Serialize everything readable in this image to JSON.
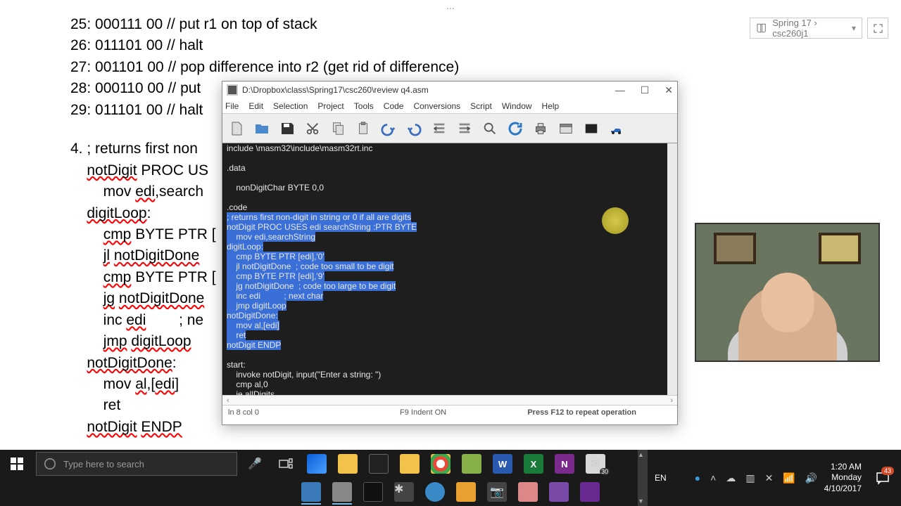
{
  "top": {
    "dots": "...",
    "notebook": "Spring 17 › csc260j1"
  },
  "doc": {
    "lines": [
      "25: 000111 00 // put r1 on top of stack",
      "26: 011101 00 // halt",
      "27: 001101 00 // pop difference into r2 (get rid of difference)",
      "28: 000110 00 // put",
      "29: 011101 00 // halt"
    ],
    "q4_num": "4.",
    "q4": [
      "    ; returns first non",
      "    notDigit PROC US",
      "        mov edi,search",
      "    digitLoop:",
      "        cmp BYTE PTR [",
      "        jl notDigitDone",
      "        cmp BYTE PTR [",
      "        jg notDigitDone",
      "        inc edi        ; ne",
      "        jmp digitLoop",
      "    notDigitDone:",
      "        mov al,[edi]",
      "        ret",
      "    notDigit ENDP"
    ]
  },
  "editor": {
    "title": "D:\\Dropbox\\class\\Spring17\\csc260\\review q4.asm",
    "menu": [
      "File",
      "Edit",
      "Selection",
      "Project",
      "Tools",
      "Code",
      "Conversions",
      "Script",
      "Window",
      "Help"
    ],
    "code": [
      {
        "t": "include \\masm32\\include\\masm32rt.inc",
        "s": 0
      },
      {
        "t": "",
        "s": 0
      },
      {
        "t": ".data",
        "s": 0
      },
      {
        "t": "",
        "s": 0
      },
      {
        "t": "    nonDigitChar BYTE 0,0",
        "s": 0
      },
      {
        "t": "",
        "s": 0
      },
      {
        "t": ".code",
        "s": 0
      },
      {
        "t": "; returns first non-digit in string or 0 if all are digits",
        "s": 1
      },
      {
        "t": "notDigit PROC USES edi searchString :PTR BYTE",
        "s": 1
      },
      {
        "t": "    mov edi,searchString",
        "s": 1
      },
      {
        "t": "digitLoop:",
        "s": 1
      },
      {
        "t": "    cmp BYTE PTR [edi],'0'",
        "s": 1
      },
      {
        "t": "    jl notDigitDone  ; code too small to be digit",
        "s": 1
      },
      {
        "t": "    cmp BYTE PTR [edi],'9'",
        "s": 1
      },
      {
        "t": "    jg notDigitDone  ; code too large to be digit",
        "s": 1
      },
      {
        "t": "    inc edi          ; next char",
        "s": 1
      },
      {
        "t": "    jmp digitLoop",
        "s": 1
      },
      {
        "t": "notDigitDone:",
        "s": 1
      },
      {
        "t": "    mov al,[edi]",
        "s": 1
      },
      {
        "t": "    ret",
        "s": 1
      },
      {
        "t": "notDigit ENDP",
        "s": 1
      },
      {
        "t": "",
        "s": 0
      },
      {
        "t": "start:",
        "s": 0
      },
      {
        "t": "    invoke notDigit, input(\"Enter a string: \")",
        "s": 0
      },
      {
        "t": "    cmp al,0",
        "s": 0
      },
      {
        "t": "    je allDigits",
        "s": 0
      }
    ],
    "status": {
      "pos": "ln 8 col 0",
      "indent": "F9 Indent ON",
      "hint": "Press F12 to repeat operation"
    }
  },
  "taskbar": {
    "search_placeholder": "Type here to search",
    "lang": "EN",
    "clock": {
      "time": "1:20 AM",
      "day": "Monday",
      "date": "4/10/2017"
    },
    "notif_count": "43",
    "mail_badge": "30"
  }
}
